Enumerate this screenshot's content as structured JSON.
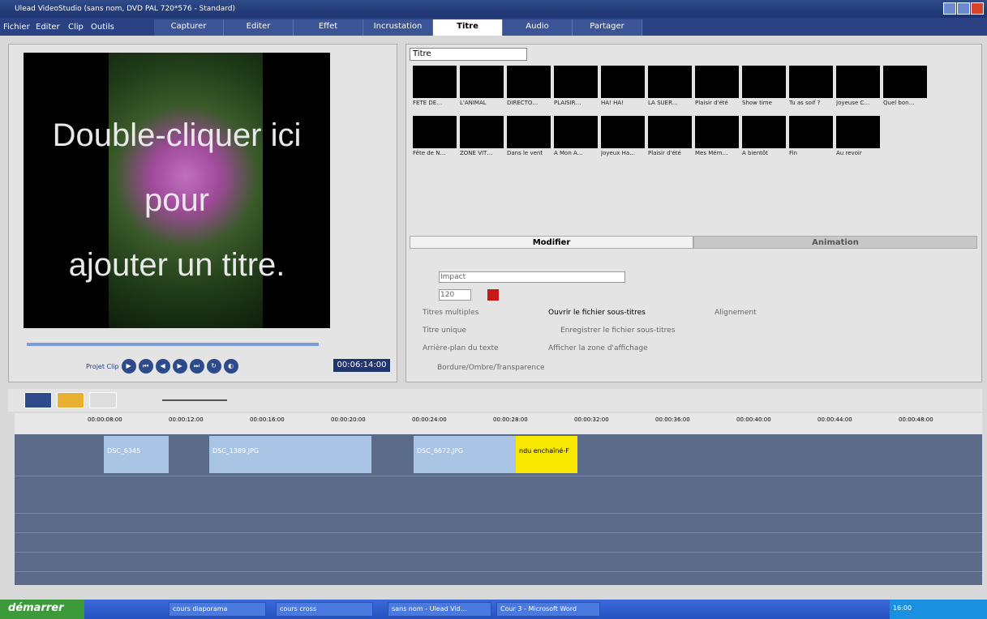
{
  "window": {
    "title": "Ulead VideoStudio (sans nom, DVD PAL 720*576 - Standard)"
  },
  "menu": [
    "Fichier",
    "Editer",
    "Clip",
    "Outils"
  ],
  "tabs": [
    "Capturer",
    "Editer",
    "Effet",
    "Incrustation",
    "Titre",
    "Audio",
    "Partager"
  ],
  "preview": {
    "line1": "Double-cliquer ici",
    "line2": "pour",
    "line3": "ajouter un titre."
  },
  "playback": {
    "mode": "Projet\nClip",
    "timecode": "00:06:14:00"
  },
  "library": {
    "selected": "Titre",
    "items": [
      "FETE DE…",
      "L'ANIMAL",
      "DIRECTO…",
      "PLAISIR…",
      "HA! HA!",
      "LA SUER…",
      "Plaisir d'été",
      "Show time",
      "Tu as soif ?",
      "Joyeuse C…",
      "Quel bon…",
      "Fête de N…",
      "ZONE VIT…",
      "Dans le vent",
      "A Mon A…",
      "Joyeux Ha…",
      "Plaisir d'été",
      "Mes Mém…",
      "A bientôt",
      "Fin",
      "Au revoir"
    ]
  },
  "tab_labels": {
    "modifier": "Modifier",
    "animation": "Animation"
  },
  "options": {
    "font": "Impact",
    "size": "120",
    "multi": "Titres multiples",
    "single": "Titre unique",
    "bg": "Arrière-plan du texte",
    "open_subs": "Ouvrir le fichier sous-titres",
    "save_subs": "Enregistrer le fichier sous-titres",
    "safe": "Afficher la zone d'affichage",
    "border": "Bordure/Ombre/Transparence",
    "align": "Alignement"
  },
  "ruler": [
    "00:00:08:00",
    "00:00:12:00",
    "00:00:16:00",
    "00:00:20:00",
    "00:00:24:00",
    "00:00:28:00",
    "00:00:32:00",
    "00:00:36:00",
    "00:00:40:00",
    "00:00:44:00",
    "00:00:48:00"
  ],
  "clips": [
    {
      "name": "DSC_6345",
      "color": "#aac4e6"
    },
    {
      "name": "DSC_1389.JPG",
      "color": "#aac4e6"
    },
    {
      "name": "DSC_6672.JPG",
      "color": "#aac4e6"
    },
    {
      "name": "ndu enchaîné-F",
      "color": "#f8e800"
    }
  ],
  "taskbar": {
    "start": "démarrer",
    "items": [
      "cours diaporama",
      "cours cross",
      "sans nom - Ulead Vid…",
      "Cour 3 - Microsoft Word"
    ],
    "clock": "16:00"
  },
  "colors": {
    "accent": "#2a4283",
    "title_fill": "#c81818"
  }
}
